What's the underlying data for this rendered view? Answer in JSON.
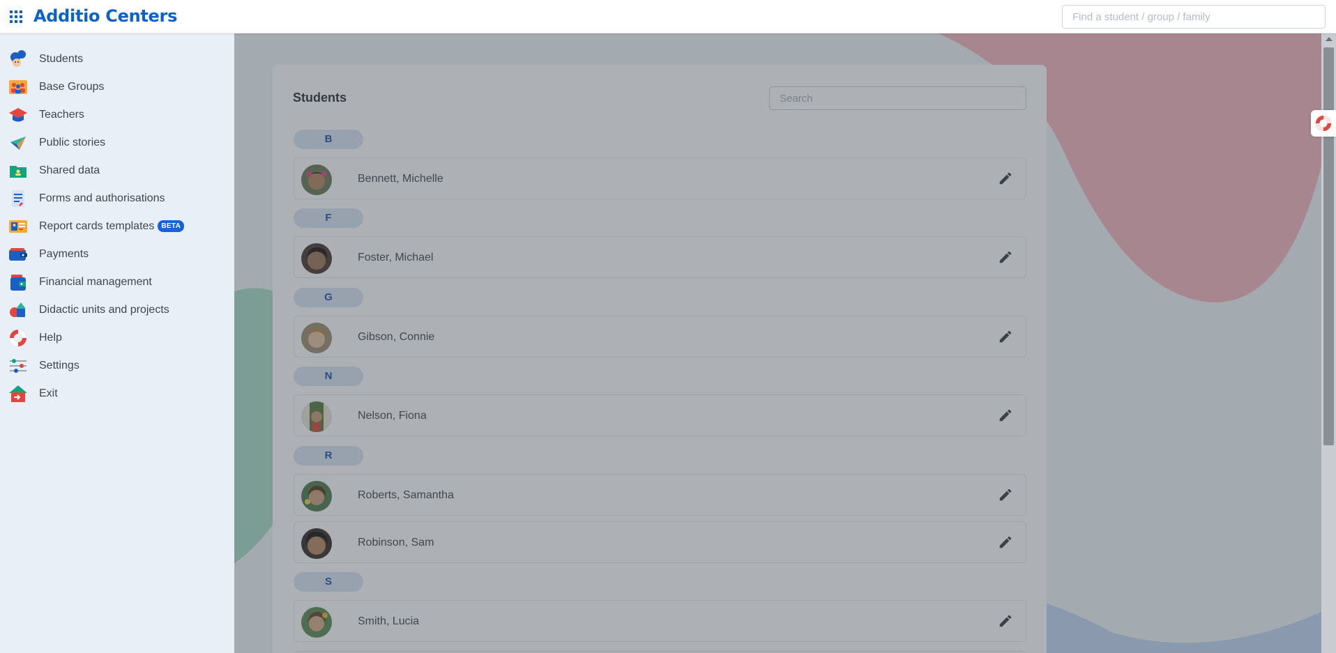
{
  "app": {
    "title": "Additio Centers"
  },
  "global_search": {
    "placeholder": "Find a student / group / family"
  },
  "sidebar": {
    "items": [
      {
        "label": "Students",
        "icon": "students-icon"
      },
      {
        "label": "Base Groups",
        "icon": "groups-icon"
      },
      {
        "label": "Teachers",
        "icon": "graduation-cap-icon"
      },
      {
        "label": "Public stories",
        "icon": "paper-plane-icon"
      },
      {
        "label": "Shared data",
        "icon": "shared-folder-icon"
      },
      {
        "label": "Forms and authorisations",
        "icon": "form-document-icon"
      },
      {
        "label": "Report cards templates",
        "icon": "report-card-icon",
        "badge": "BETA"
      },
      {
        "label": "Payments",
        "icon": "wallet-icon"
      },
      {
        "label": "Financial management",
        "icon": "finance-wallet-icon"
      },
      {
        "label": "Didactic units and projects",
        "icon": "shapes-icon"
      },
      {
        "label": "Help",
        "icon": "lifebuoy-icon"
      },
      {
        "label": "Settings",
        "icon": "sliders-icon"
      },
      {
        "label": "Exit",
        "icon": "exit-house-icon"
      }
    ]
  },
  "students": {
    "title": "Students",
    "search_placeholder": "Search",
    "groups": [
      {
        "letter": "B",
        "names": [
          "Bennett, Michelle"
        ]
      },
      {
        "letter": "F",
        "names": [
          "Foster, Michael"
        ]
      },
      {
        "letter": "G",
        "names": [
          "Gibson, Connie"
        ]
      },
      {
        "letter": "N",
        "names": [
          "Nelson, Fiona"
        ]
      },
      {
        "letter": "R",
        "names": [
          "Roberts, Samantha",
          "Robinson, Sam"
        ]
      },
      {
        "letter": "S",
        "names": [
          "Smith, Lucia"
        ]
      }
    ]
  },
  "colors": {
    "brand": "#0b63c9",
    "sidebar_bg": "#e9eff7",
    "beta_badge": "#1565d8",
    "letter_chip": "#dbe6f5"
  }
}
